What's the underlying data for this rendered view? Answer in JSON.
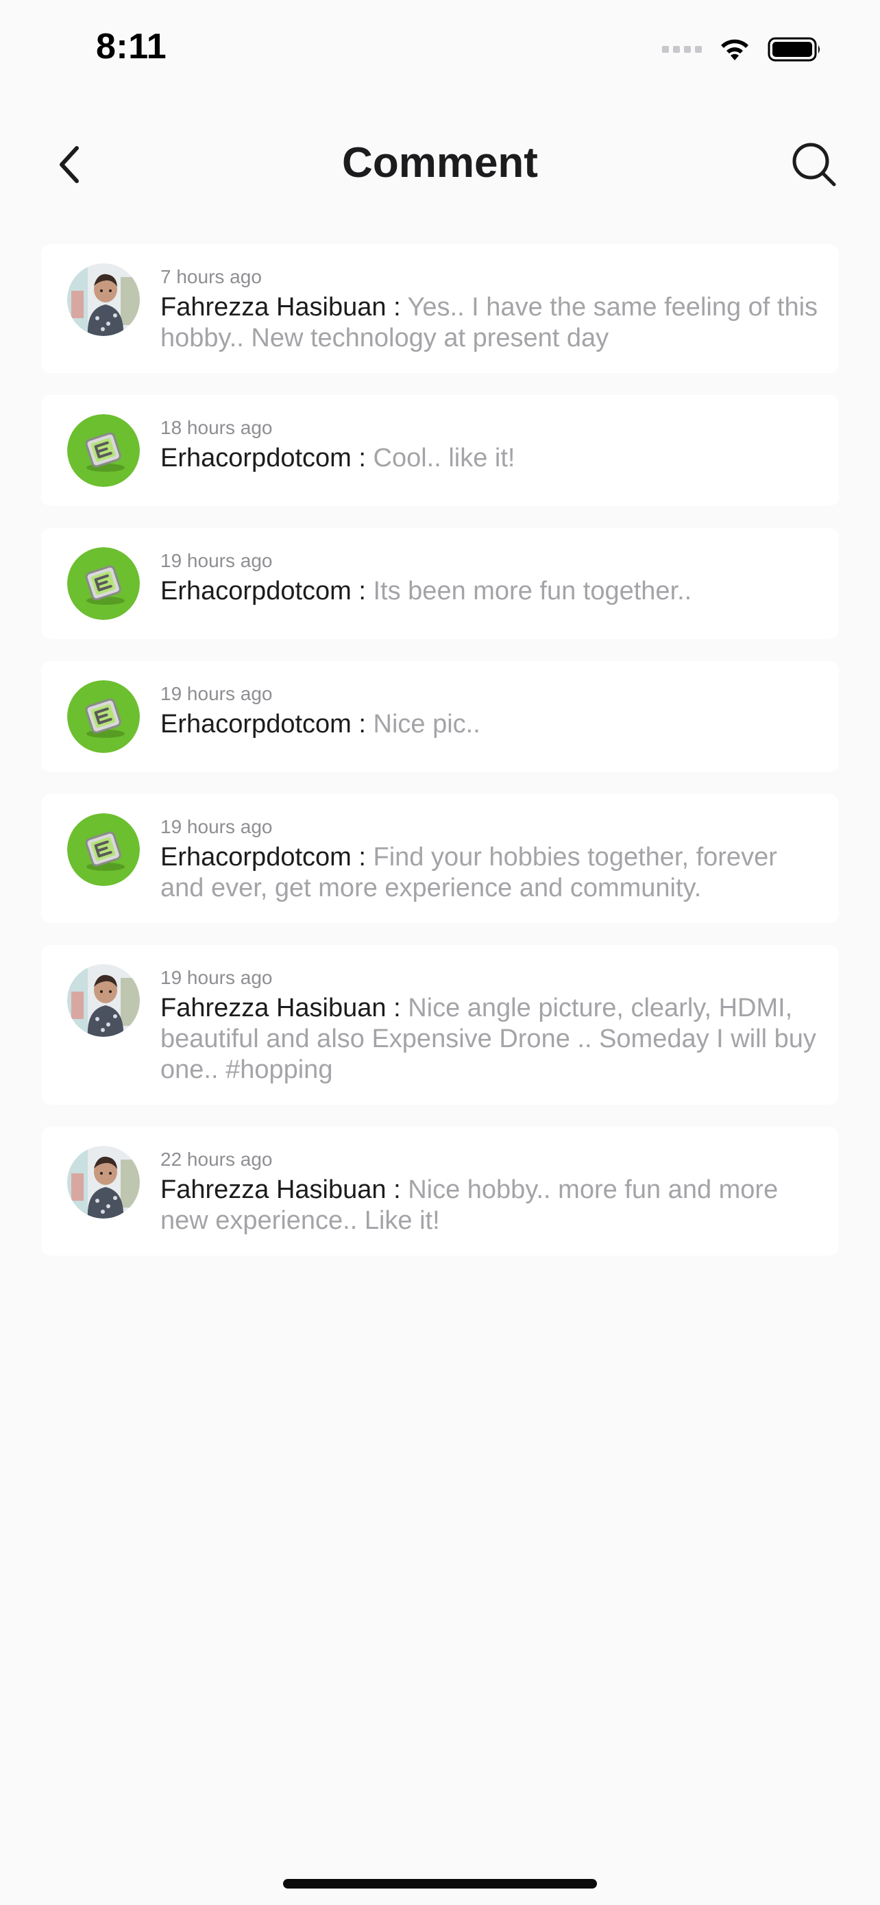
{
  "status_bar": {
    "time": "8:11",
    "icons": [
      "cellular-signal-icon",
      "wifi-icon",
      "battery-icon"
    ]
  },
  "nav": {
    "back_icon": "chevron-left-icon",
    "title": "Comment",
    "search_icon": "search-icon"
  },
  "separator": " : ",
  "comments": [
    {
      "time": "7 hours ago",
      "author": "Fahrezza Hasibuan",
      "message": "Yes.. I have the same feeling of this hobby.. New technology at present day",
      "avatar": "person-photo"
    },
    {
      "time": "18 hours ago",
      "author": "Erhacorpdotcom",
      "message": "Cool.. like it!",
      "avatar": "green-logo"
    },
    {
      "time": "19 hours ago",
      "author": "Erhacorpdotcom",
      "message": "Its been more fun together..",
      "avatar": "green-logo"
    },
    {
      "time": "19 hours ago",
      "author": "Erhacorpdotcom",
      "message": "Nice pic..",
      "avatar": "green-logo"
    },
    {
      "time": "19 hours ago",
      "author": "Erhacorpdotcom",
      "message": "Find your hobbies together, forever and ever, get more experience and community.",
      "avatar": "green-logo"
    },
    {
      "time": "19 hours ago",
      "author": "Fahrezza Hasibuan",
      "message": "Nice angle picture, clearly, HDMI, beautiful and also Expensive Drone .. Someday I will buy one.. #hopping",
      "avatar": "person-photo"
    },
    {
      "time": "22 hours ago",
      "author": "Fahrezza Hasibuan",
      "message": "Nice hobby.. more fun and more new experience.. Like it!",
      "avatar": "person-photo"
    }
  ],
  "colors": {
    "background": "#fafafa",
    "card": "#ffffff",
    "author_text": "#1c1c1e",
    "message_text": "#a4a4a8",
    "time_text": "#8e8e93",
    "logo_green": "#6cbf2f"
  }
}
